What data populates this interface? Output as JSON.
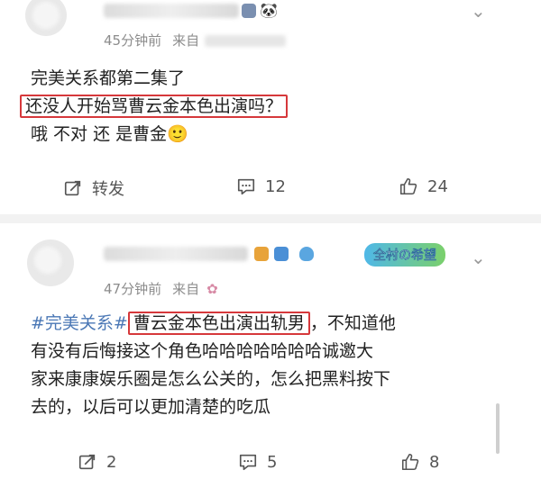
{
  "post1": {
    "time": "45分钟前",
    "from_label": "来自",
    "lines": [
      "完美关系都第二集了",
      "还没人开始骂曹云金本色出演吗？",
      "哦 不对 还 是曹金🙂"
    ],
    "actions": {
      "repost": "转发",
      "comments": "12",
      "likes": "24"
    }
  },
  "post2": {
    "time": "47分钟前",
    "from_label": "来自",
    "fan_badge": "全村の希望",
    "tag": "#完美关系#",
    "highlight": "曹云金本色出演出轨男",
    "line1_rest": "，不知道他",
    "line2": "有没有后悔接这个角色哈哈哈哈哈哈哈诚邀大",
    "line3": "家来康康娱乐圈是怎么公关的，怎么把黑料按下",
    "line4": "去的，以后可以更加清楚的吃瓜",
    "actions": {
      "repost": "2",
      "comments": "5",
      "likes": "8"
    }
  },
  "colors": {
    "highlight_border": "#d6383b",
    "topic": "#4a77b5",
    "meta": "#8c8c8c"
  }
}
